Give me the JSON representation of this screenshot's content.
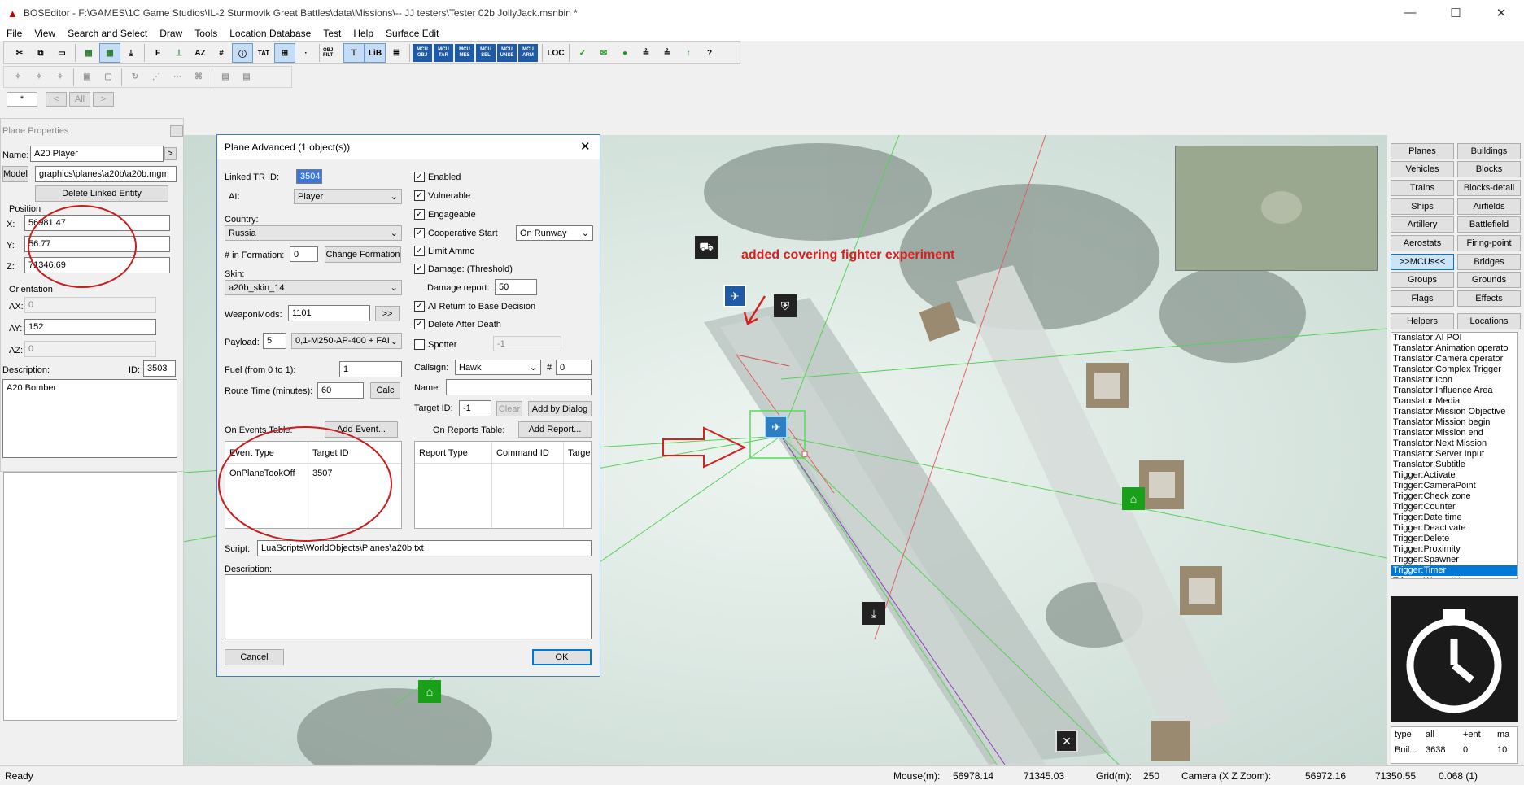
{
  "window": {
    "title": "BOSEditor - F:\\GAMES\\1C Game Studios\\IL-2 Sturmovik Great Battles\\data\\Missions\\-- JJ testers\\Tester 02b JollyJack.msnbin *",
    "min": "—",
    "max": "☐",
    "close": "✕"
  },
  "menu": [
    "File",
    "View",
    "Search and Select",
    "Draw",
    "Tools",
    "Location Database",
    "Test",
    "Help",
    "Surface Edit"
  ],
  "toolbar": {
    "mcu_buttons": [
      [
        "MCU",
        "OBJ"
      ],
      [
        "MCU",
        "TAR"
      ],
      [
        "MCU",
        "MES"
      ],
      [
        "MCU",
        "SEL"
      ],
      [
        "MCU",
        "UNSE"
      ],
      [
        "MCU",
        "ARM"
      ]
    ],
    "obj_filt": "OBJ FILT",
    "tat": "TAT",
    "lib": "LiB",
    "loc": "LOC"
  },
  "toolbar3": {
    "star": "*",
    "prev": "<",
    "all": "All",
    "next": ">"
  },
  "plane_properties": {
    "title": "Plane Properties",
    "name_label": "Name:",
    "name_value": "A20 Player",
    "name_btn": ">",
    "model_btn": "Model",
    "model_value": "graphics\\planes\\a20b\\a20b.mgm",
    "delete_linked": "Delete Linked Entity",
    "position_label": "Position",
    "x_label": "X:",
    "x": "56981.47",
    "y_label": "Y:",
    "y": "56.77",
    "z_label": "Z:",
    "z": "71346.69",
    "orientation_label": "Orientation",
    "ax_label": "AX:",
    "ax": "0",
    "ay_label": "AY:",
    "ay": "152",
    "az_label": "AZ:",
    "az": "0",
    "description_label": "Description:",
    "id_label": "ID:",
    "id": "3503",
    "description": "A20 Bomber"
  },
  "dialog": {
    "title": "Plane Advanced (1 object(s))",
    "close": "✕",
    "linked_tr_label": "Linked TR ID:",
    "linked_tr": "3504",
    "ai_label": "AI:",
    "ai": "Player",
    "country_label": "Country:",
    "country": "Russia",
    "formation_label": "# in Formation:",
    "formation": "0",
    "change_formation": "Change Formation",
    "skin_label": "Skin:",
    "skin": "a20b_skin_14",
    "weaponmods_label": "WeaponMods:",
    "weaponmods": "1101",
    "weaponmods_btn": ">>",
    "payload_label": "Payload:",
    "payload_num": "5",
    "payload": "0,1-M250-AP-400 + FAI",
    "fuel_label": "Fuel (from 0 to 1):",
    "fuel": "1",
    "route_label": "Route Time (minutes):",
    "route": "60",
    "calc": "Calc",
    "enabled": "Enabled",
    "vulnerable": "Vulnerable",
    "engageable": "Engageable",
    "coop_start": "Cooperative Start",
    "coop_mode": "On Runway",
    "limit_ammo": "Limit Ammo",
    "damage": "Damage: (Threshold)",
    "damage_report_label": "Damage report:",
    "damage_report": "50",
    "ai_rtb": "AI Return to Base Decision",
    "delete_after_death": "Delete After Death",
    "spotter": "Spotter",
    "spotter_val": "-1",
    "callsign_label": "Callsign:",
    "callsign": "Hawk",
    "hash": "#",
    "callnum": "0",
    "name_label": "Name:",
    "target_label": "Target ID:",
    "target": "-1",
    "clear": "Clear",
    "add_dialog": "Add by Dialog",
    "events_label": "On Events Table:",
    "add_event": "Add Event...",
    "reports_label": "On Reports Table:",
    "add_report": "Add Report...",
    "events_cols": [
      "Event Type",
      "Target ID"
    ],
    "events_rows": [
      [
        "OnPlaneTookOff",
        "3507"
      ]
    ],
    "reports_cols": [
      "Report Type",
      "Command ID",
      "Targe"
    ],
    "script_label": "Script:",
    "script": "LuaScripts\\WorldObjects\\Planes\\a20b.txt",
    "desc_label": "Description:",
    "cancel": "Cancel",
    "ok": "OK"
  },
  "annotation": "added covering fighter experiment",
  "right_panel": {
    "buttons": [
      [
        "Planes",
        "Buildings"
      ],
      [
        "Vehicles",
        "Blocks"
      ],
      [
        "Trains",
        "Blocks-detail"
      ],
      [
        "Ships",
        "Airfields"
      ],
      [
        "Artillery",
        "Battlefield"
      ],
      [
        "Aerostats",
        "Firing-point"
      ],
      [
        ">>MCUs<<",
        "Bridges"
      ],
      [
        "Groups",
        "Grounds"
      ],
      [
        "Flags",
        "Effects"
      ]
    ],
    "helpers": "Helpers",
    "locations": "Locations",
    "list": [
      "Translator:AI POI",
      "Translator:Animation operato",
      "Translator:Camera operator",
      "Translator:Complex Trigger",
      "Translator:Icon",
      "Translator:Influence Area",
      "Translator:Media",
      "Translator:Mission Objective",
      "Translator:Mission begin",
      "Translator:Mission end",
      "Translator:Next Mission",
      "Translator:Server Input",
      "Translator:Subtitle",
      "Trigger:Activate",
      "Trigger:CameraPoint",
      "Trigger:Check zone",
      "Trigger:Counter",
      "Trigger:Date time",
      "Trigger:Deactivate",
      "Trigger:Delete",
      "Trigger:Proximity",
      "Trigger:Spawner",
      "Trigger:Timer",
      "Trigger:Waypoint"
    ],
    "selected": "Trigger:Timer",
    "stats_cols": [
      "type",
      "all",
      "+ent",
      "ma"
    ],
    "stats_row": [
      "Buil...",
      "3638",
      "0",
      "10"
    ]
  },
  "status": {
    "ready": "Ready",
    "mouse_label": "Mouse(m):",
    "mouse_x": "56978.14",
    "mouse_z": "71345.03",
    "grid_label": "Grid(m):",
    "grid": "250",
    "camera_label": "Camera (X  Z  Zoom):",
    "cam_x": "56972.16",
    "cam_z": "71350.55",
    "zoom": "0.068 (1)"
  },
  "colors": {
    "accent": "#0078d7",
    "annotation": "#d62020",
    "mcu_blue": "#1f5aa8"
  }
}
